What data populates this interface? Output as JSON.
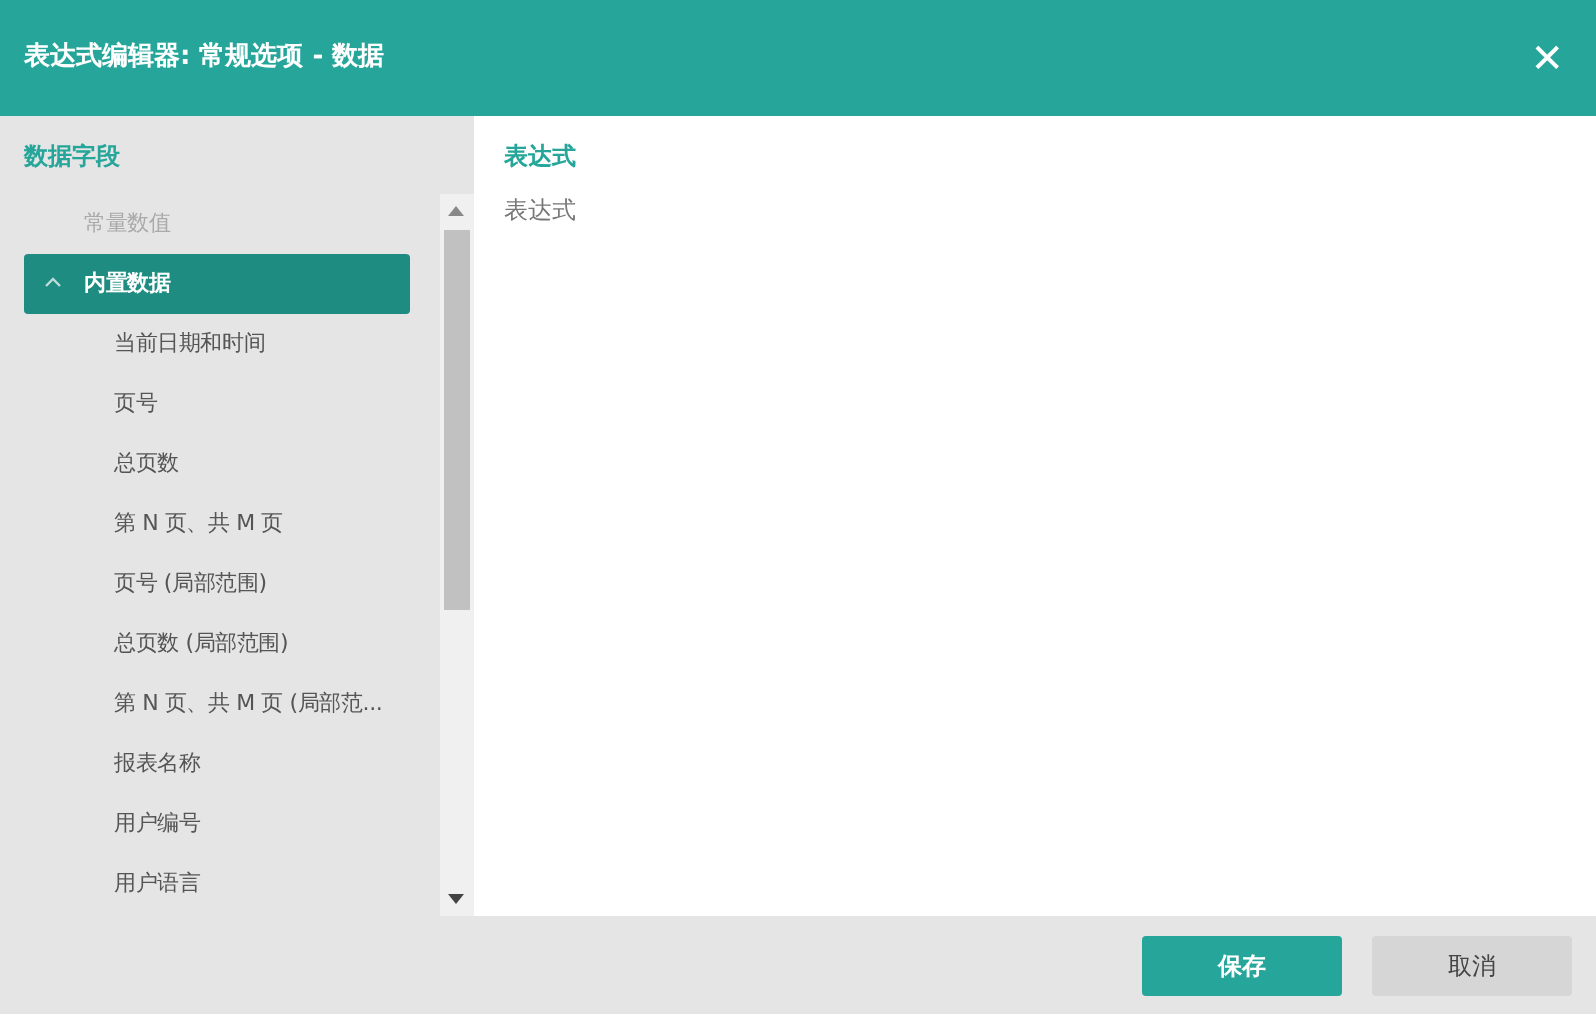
{
  "window": {
    "title": "表达式编辑器: 常规选项 - 数据",
    "close": "✕"
  },
  "fields_panel": {
    "heading": "数据字段",
    "tree": [
      {
        "label": "常量数值",
        "disabled": true,
        "selected": false
      },
      {
        "label": "内置数据",
        "disabled": false,
        "selected": true,
        "expanded": true,
        "children": [
          {
            "label": "当前日期和时间",
            "selected": false
          },
          {
            "label": "页号",
            "selected": false
          },
          {
            "label": "总页数",
            "selected": false
          },
          {
            "label": "第 N 页、共 M 页",
            "selected": false
          },
          {
            "label": "页号 (局部范围)",
            "selected": false
          },
          {
            "label": "总页数 (局部范围)",
            "selected": false
          },
          {
            "label": "第 N 页、共 M 页 (局部范...",
            "selected": false
          },
          {
            "label": "报表名称",
            "selected": false
          },
          {
            "label": "用户编号",
            "selected": false
          },
          {
            "label": "用户语言",
            "selected": false
          }
        ]
      }
    ]
  },
  "expression_panel": {
    "heading": "表达式",
    "placeholder": "表达式"
  },
  "buttons": [
    {
      "label": "保存",
      "kind": "primary"
    },
    {
      "label": "取消",
      "kind": "secondary"
    }
  ]
}
